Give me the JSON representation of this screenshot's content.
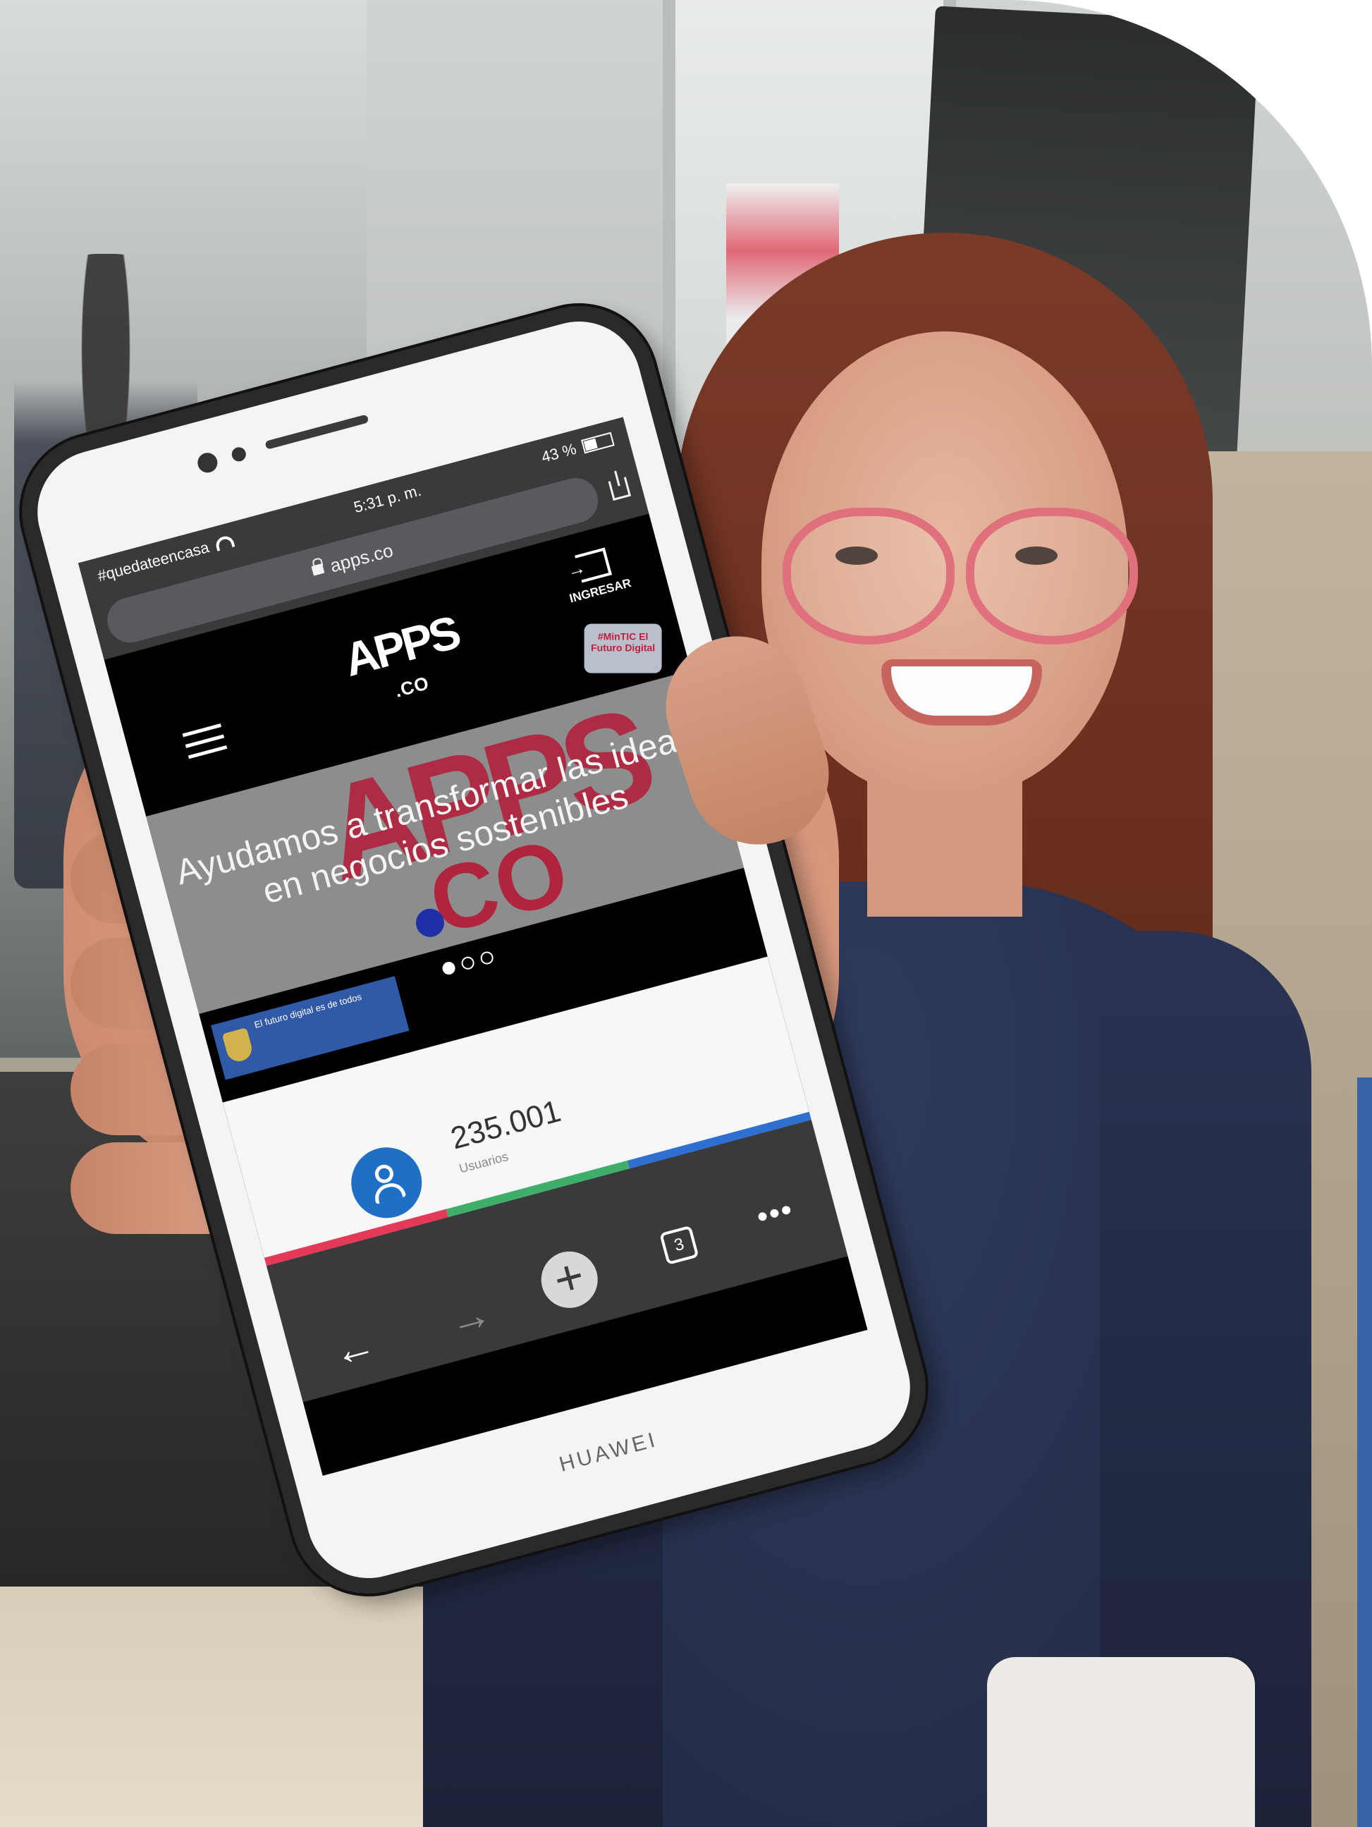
{
  "status_bar": {
    "carrier": "#quedateencasa",
    "time": "5:31 p. m.",
    "battery": "43 %",
    "battery_level": 0.43
  },
  "browser": {
    "url": "apps.co",
    "share_icon": "share-icon",
    "lock_icon": "lock-icon"
  },
  "site_header": {
    "logo_top": "APPS",
    "logo_bottom": ".CO",
    "login_label": "INGRESAR",
    "menu_icon": "hamburger-menu-icon",
    "badge_text": "#MinTIC El Futuro Digital"
  },
  "hero": {
    "background_word": "APPS",
    "background_word_2": "CO",
    "tagline": "Ayudamos a transformar las ideas en negocios sostenibles",
    "slide_count": 3,
    "active_slide": 1
  },
  "gov_banner": {
    "text": "El futuro digital es de todos",
    "ministry": "MinTIC"
  },
  "stats": {
    "value": "235.001",
    "label": "Usuarios",
    "icon": "user-icon",
    "line_colors": [
      "#e23a57",
      "#3fae6a",
      "#2f6fd0"
    ]
  },
  "toolbar": {
    "back_icon": "←",
    "forward_icon": "→",
    "new_tab_icon": "+",
    "tab_count": "3",
    "more_icon": "•••"
  },
  "device": {
    "brand": "HUAWEI"
  },
  "colors": {
    "accent_red": "#b0243e",
    "accent_blue": "#3a63a8"
  }
}
